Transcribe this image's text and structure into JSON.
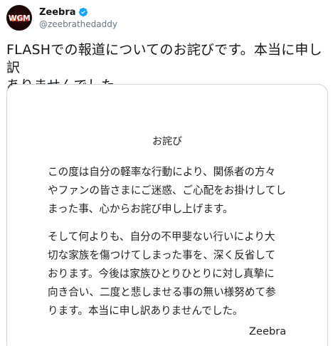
{
  "user": {
    "display_name": "Zeebra",
    "handle": "@zeebrathedaddy",
    "avatar_icon": "avatar-logo",
    "avatar_logo_text": "WGM",
    "verified_icon": "verified-badge-icon",
    "verified_color": "#1da1f2"
  },
  "tweet": {
    "text_line1": "FLASHでの報道についてのお詫びです。本当に申し訳",
    "text_line2": "ありませんでした。"
  },
  "document": {
    "title": "お詫び",
    "para1": [
      "この度は自分の軽率な行動により、関係者の方々",
      "やファンの皆さまにご迷惑、ご心配をお掛けしてし",
      "まった事、心からお詫び申し上げます。"
    ],
    "para2": [
      "そして何よりも、自分の不甲斐ない行いにより大",
      "切な家族を傷つけてしまった事を、深く反省して",
      "おります。今後は家族ひとりひとりに対し真摯に",
      "向き合い、二度と悲しませる事の無い様努めて参",
      "ります。本当に申し訳ありませんでした。"
    ],
    "signature": "Zeebra"
  }
}
